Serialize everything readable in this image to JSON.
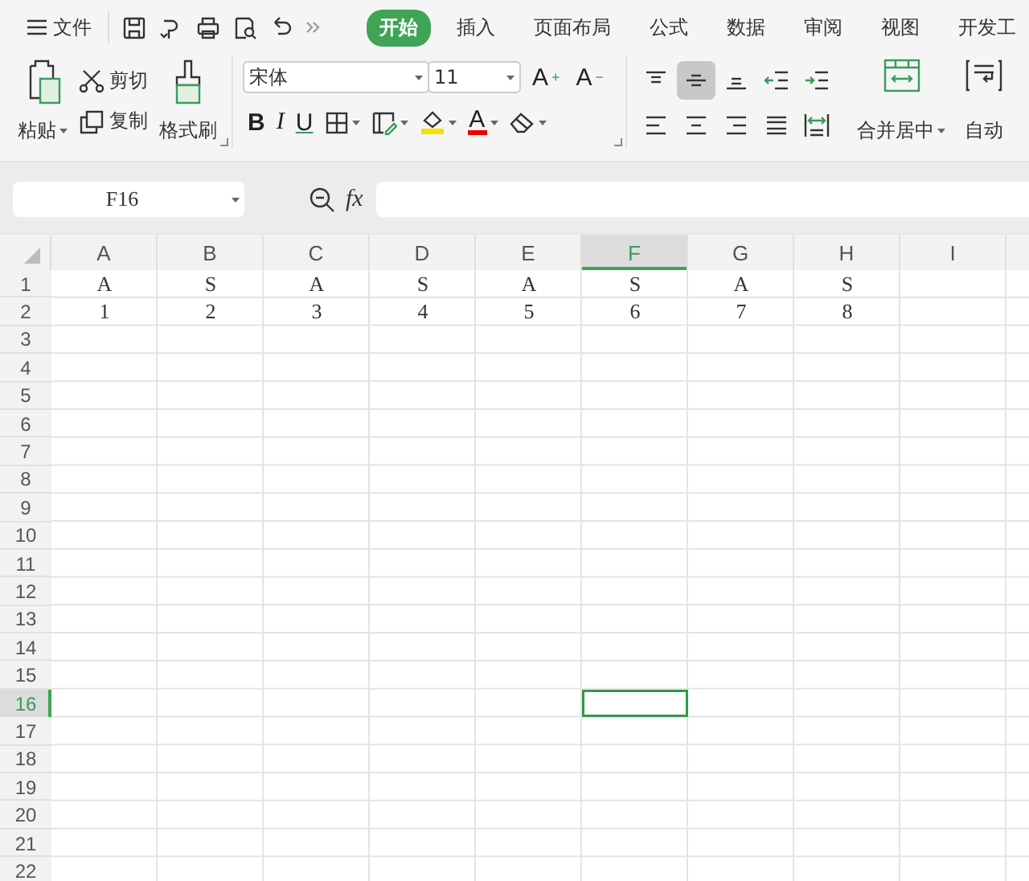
{
  "menu": {
    "label": "文件"
  },
  "tabs": [
    {
      "label": "开始",
      "selected": true
    },
    {
      "label": "插入",
      "selected": false
    },
    {
      "label": "页面布局",
      "selected": false
    },
    {
      "label": "公式",
      "selected": false
    },
    {
      "label": "数据",
      "selected": false
    },
    {
      "label": "审阅",
      "selected": false
    },
    {
      "label": "视图",
      "selected": false
    },
    {
      "label": "开发工",
      "selected": false
    }
  ],
  "clipboard": {
    "paste": "粘贴",
    "cut": "剪切",
    "copy": "复制",
    "format_painter": "格式刷"
  },
  "font": {
    "name": "宋体",
    "size": "11",
    "grow": "A",
    "grow_sign": "+",
    "shrink": "A",
    "shrink_sign": "−",
    "bold": "B",
    "italic": "I",
    "underline": "U",
    "font_color": "A"
  },
  "alignment": [
    {
      "kind": "top",
      "selected": false
    },
    {
      "kind": "middle",
      "selected": true
    },
    {
      "kind": "bottom",
      "selected": false
    },
    {
      "kind": "outdent",
      "selected": false
    },
    {
      "kind": "indent",
      "selected": false
    },
    {
      "kind": "left",
      "selected": false
    },
    {
      "kind": "center",
      "selected": false
    },
    {
      "kind": "right",
      "selected": false
    },
    {
      "kind": "justify",
      "selected": false
    },
    {
      "kind": "distribute",
      "selected": false
    }
  ],
  "merge": {
    "label": "合并居中"
  },
  "wrap": {
    "label": "自动"
  },
  "formula_bar": {
    "name_box": "F16",
    "fx": "fx"
  },
  "grid": {
    "columns": [
      {
        "label": "A",
        "selected": false
      },
      {
        "label": "B",
        "selected": false
      },
      {
        "label": "C",
        "selected": false
      },
      {
        "label": "D",
        "selected": false
      },
      {
        "label": "E",
        "selected": false
      },
      {
        "label": "F",
        "selected": true
      },
      {
        "label": "G",
        "selected": false
      },
      {
        "label": "H",
        "selected": false
      },
      {
        "label": "I",
        "selected": false
      }
    ],
    "rows": [
      {
        "label": "1",
        "selected": false
      },
      {
        "label": "2",
        "selected": false
      },
      {
        "label": "3",
        "selected": false
      },
      {
        "label": "4",
        "selected": false
      },
      {
        "label": "5",
        "selected": false
      },
      {
        "label": "6",
        "selected": false
      },
      {
        "label": "7",
        "selected": false
      },
      {
        "label": "8",
        "selected": false
      },
      {
        "label": "9",
        "selected": false
      },
      {
        "label": "10",
        "selected": false
      },
      {
        "label": "11",
        "selected": false
      },
      {
        "label": "12",
        "selected": false
      },
      {
        "label": "13",
        "selected": false
      },
      {
        "label": "14",
        "selected": false
      },
      {
        "label": "15",
        "selected": false
      },
      {
        "label": "16",
        "selected": true
      },
      {
        "label": "17",
        "selected": false
      },
      {
        "label": "18",
        "selected": false
      },
      {
        "label": "19",
        "selected": false
      },
      {
        "label": "20",
        "selected": false
      },
      {
        "label": "21",
        "selected": false
      },
      {
        "label": "22",
        "selected": false
      }
    ],
    "cells": [
      [
        "A",
        "S",
        "A",
        "S",
        "A",
        "S",
        "A",
        "S"
      ],
      [
        "1",
        "2",
        "3",
        "4",
        "5",
        "6",
        "7",
        "8"
      ]
    ]
  }
}
